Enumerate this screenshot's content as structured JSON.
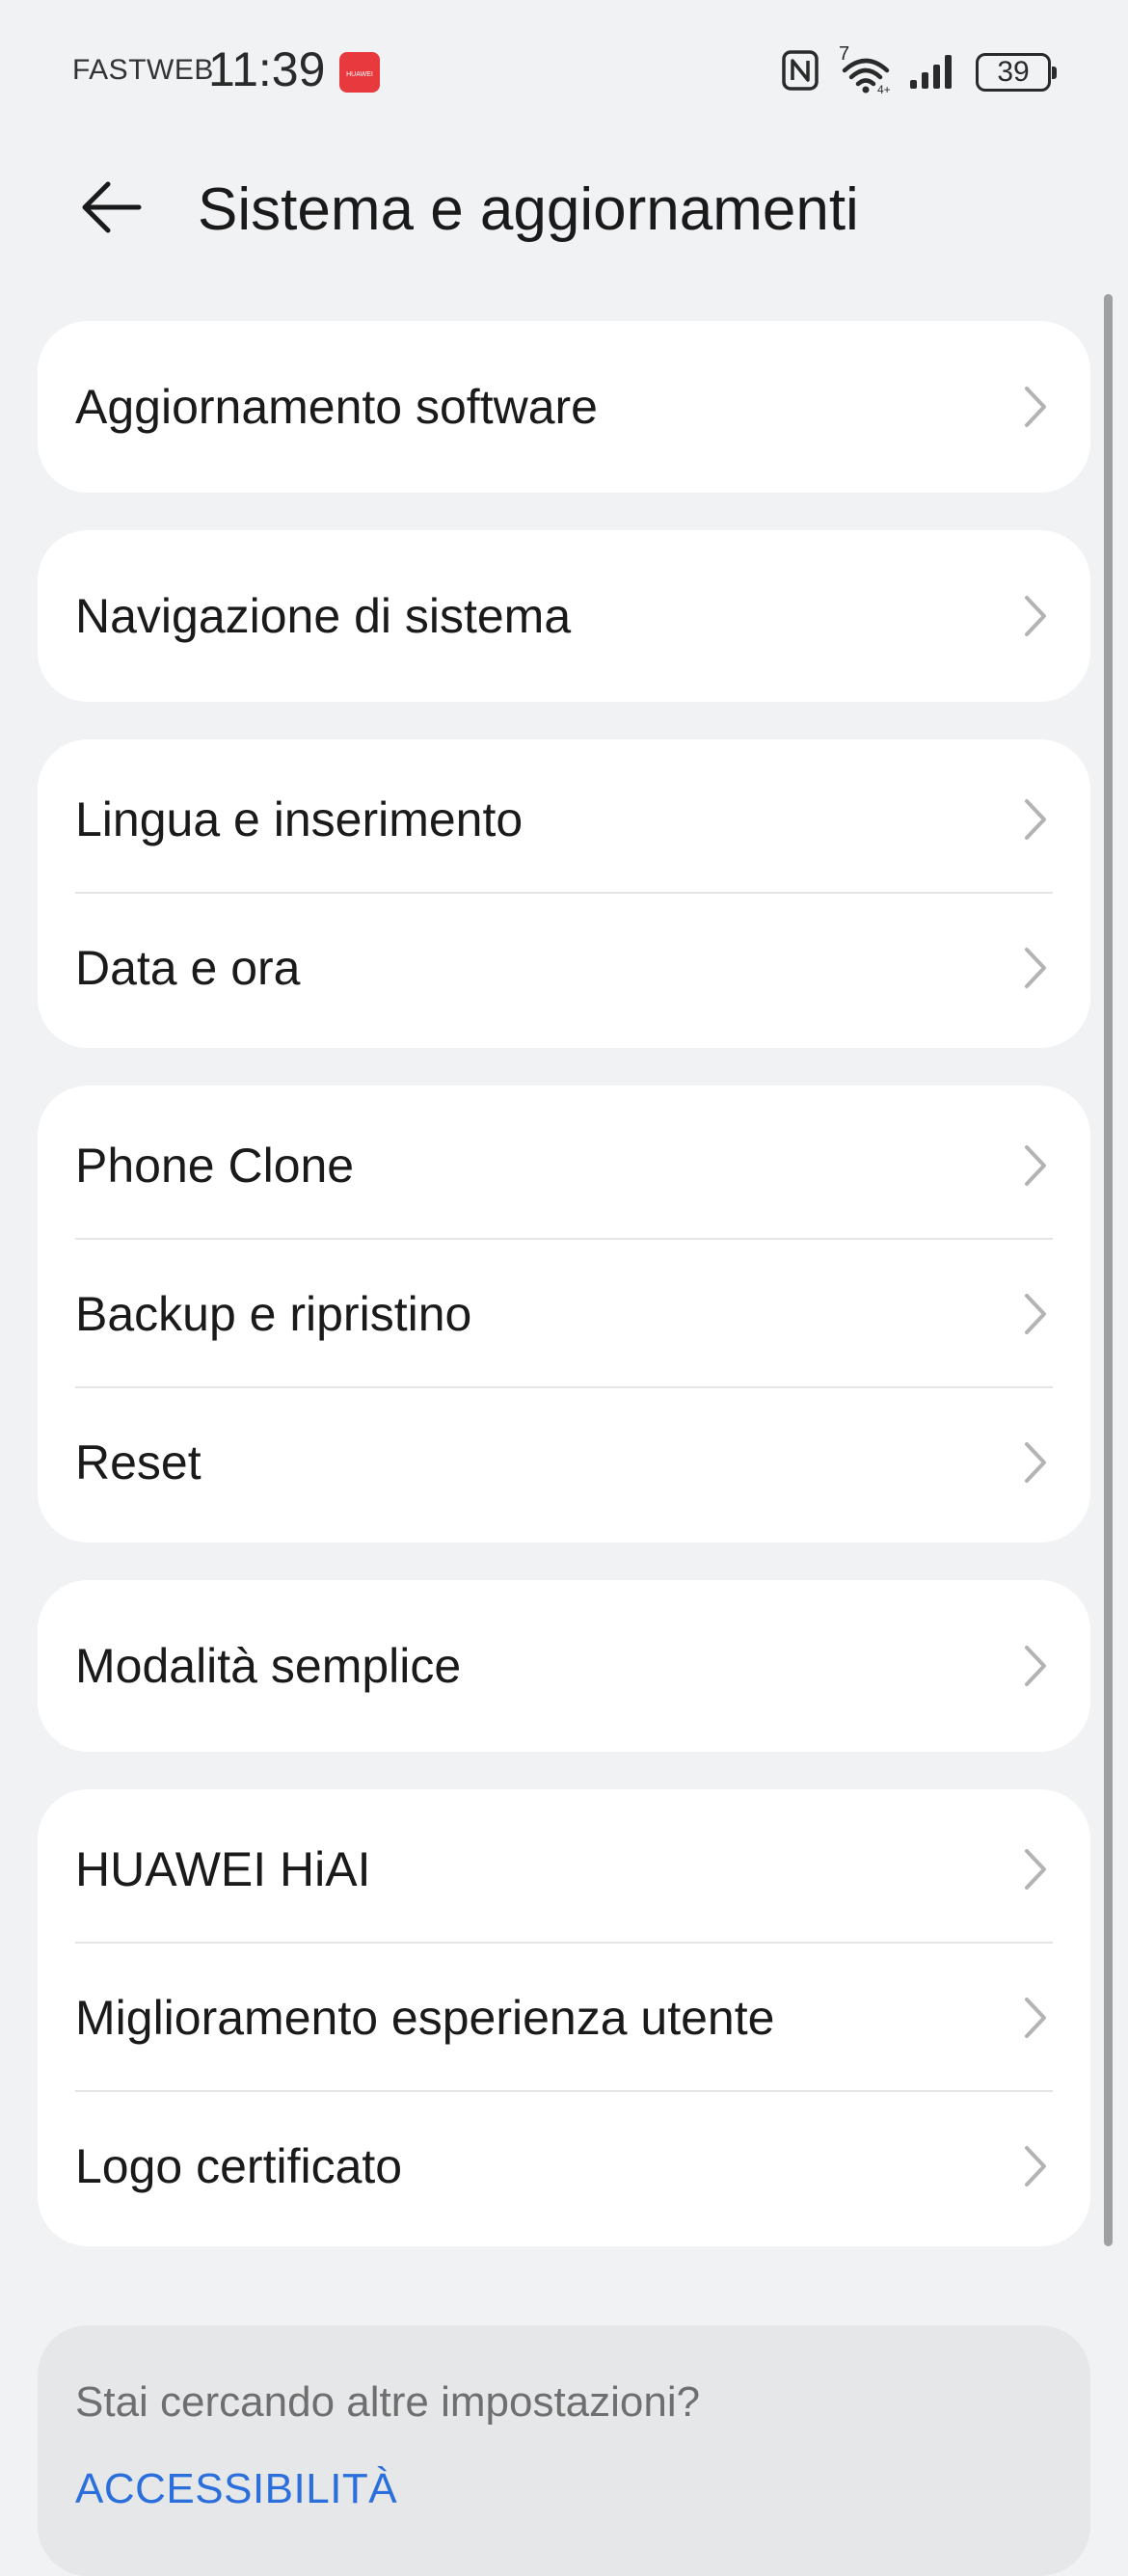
{
  "status_bar": {
    "carrier": "FASTWEB",
    "time": "11:39",
    "app_badge_text": "HUAWEI",
    "battery": "39",
    "wifi_badge": "7"
  },
  "header": {
    "back_icon": "arrow-left-icon",
    "title": "Sistema e aggiornamenti"
  },
  "groups": [
    {
      "items": [
        "Aggiornamento software"
      ]
    },
    {
      "items": [
        "Navigazione di sistema"
      ]
    },
    {
      "items": [
        "Lingua e inserimento",
        "Data e ora"
      ]
    },
    {
      "items": [
        "Phone Clone",
        "Backup e ripristino",
        "Reset"
      ]
    },
    {
      "items": [
        "Modalità semplice"
      ]
    },
    {
      "items": [
        "HUAWEI HiAI",
        "Miglioramento esperienza utente",
        "Logo certificato"
      ]
    }
  ],
  "suggestion": {
    "title": "Stai cercando altre impostazioni?",
    "link": "ACCESSIBILITÀ"
  },
  "colors": {
    "background": "#f1f2f4",
    "card": "#ffffff",
    "accent_link": "#2a6fdb",
    "badge_red": "#e8393f"
  }
}
